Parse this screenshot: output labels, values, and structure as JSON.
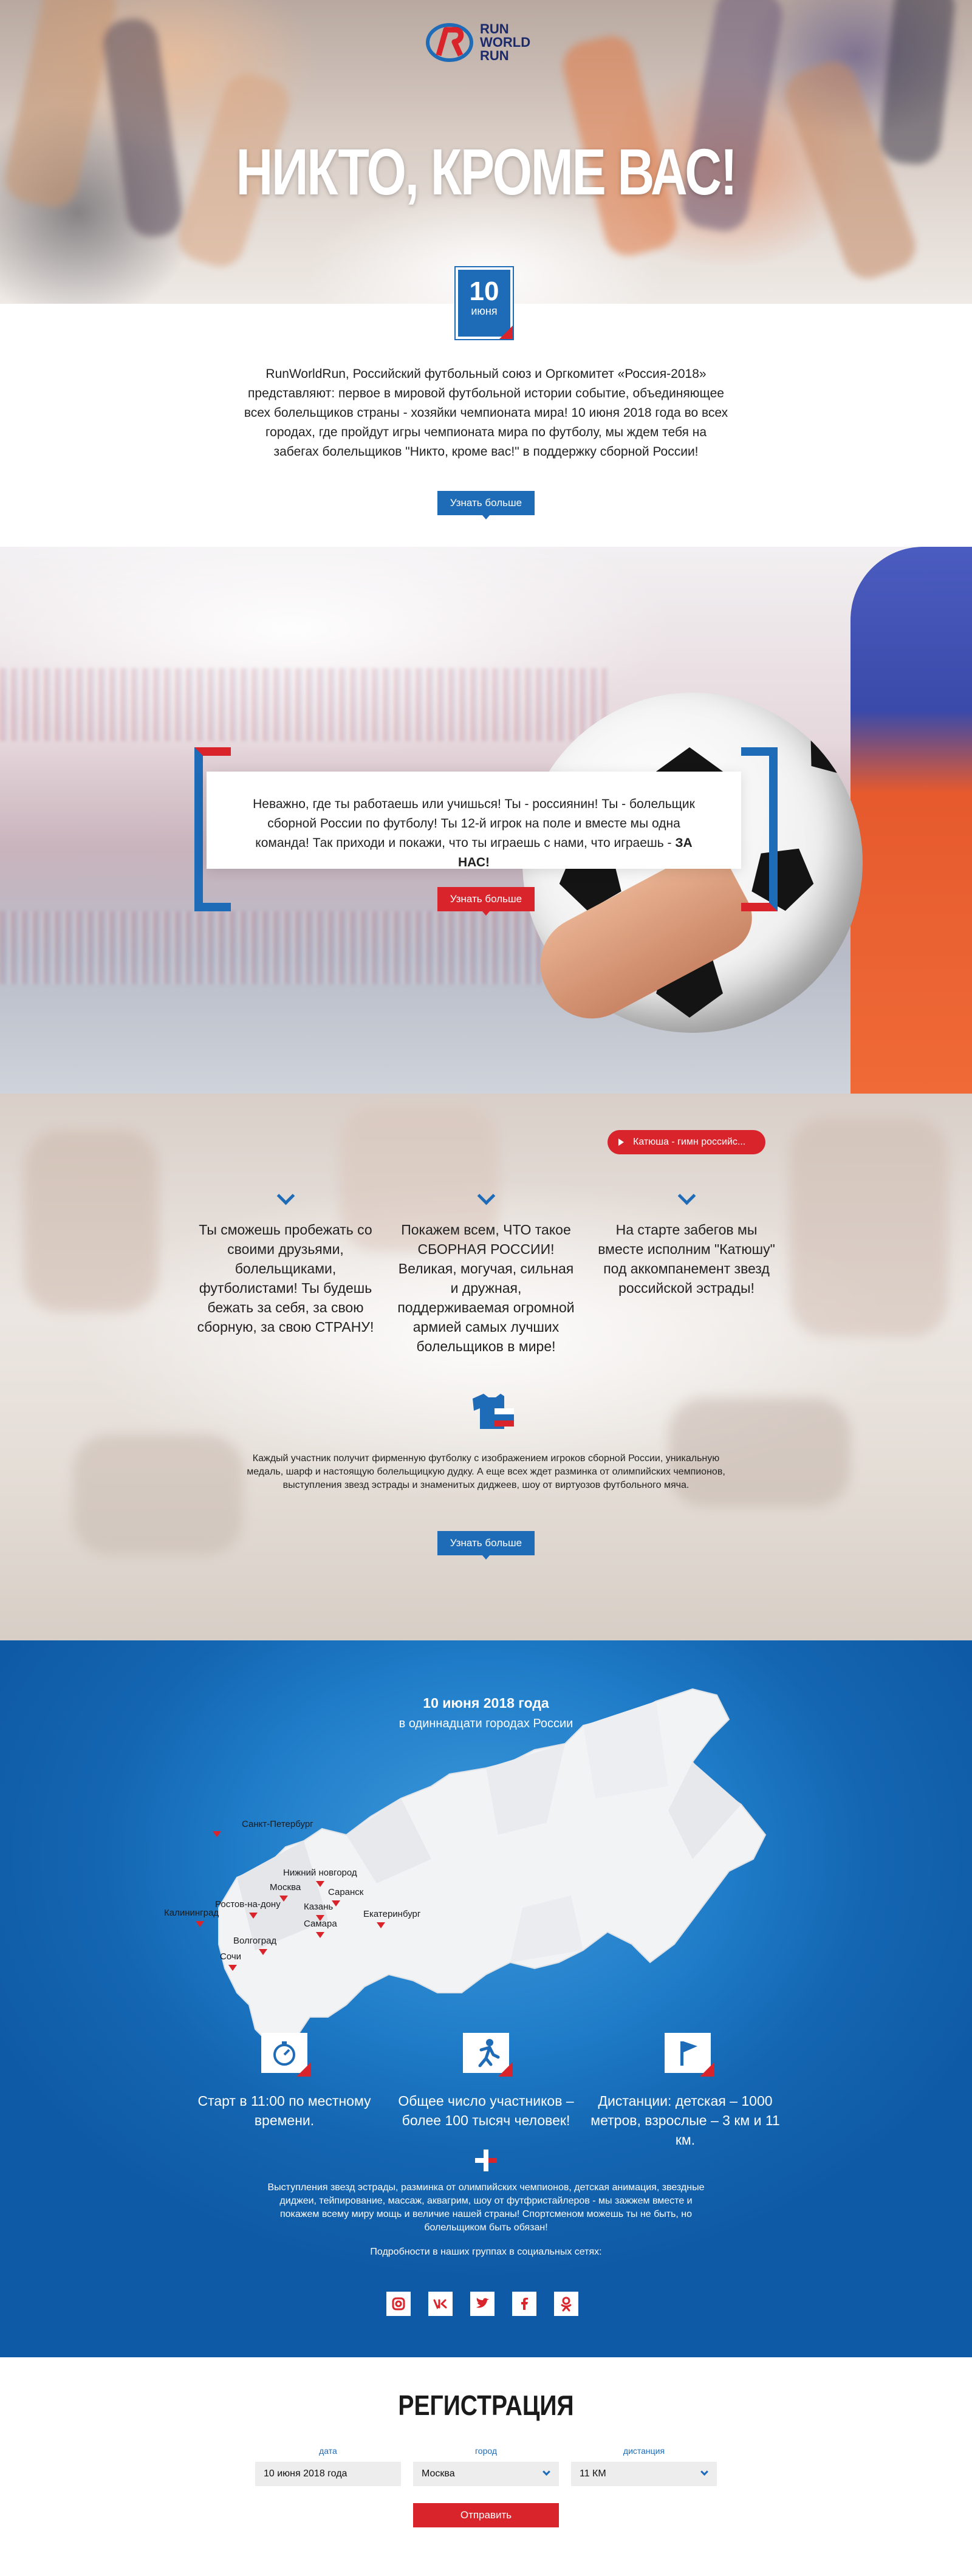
{
  "brand": {
    "logo_line1": "RUN",
    "logo_line2": "WORLD",
    "logo_line3": "RUN",
    "blue": "#1e6bb8",
    "red": "#d8242a"
  },
  "hero": {
    "title": "НИКТО, КРОМЕ ВАС!"
  },
  "date_badge": {
    "day": "10",
    "month": "июня"
  },
  "intro": {
    "text": "RunWorldRun, Российский футбольный союз и Оргкомитет «Россия-2018» представляют: первое в мировой футбольной истории событие, объединяющее всех болельщиков страны - хозяйки чемпионата мира! 10 июня 2018 года во всех городах, где пройдут игры чемпионата мира по футболу, мы ждем тебя на забегах болельщиков \"Никто, кроме вас!\" в поддержку сборной России!",
    "button": "Узнать больше"
  },
  "ball_section": {
    "text": "Неважно, где ты работаешь или учишься! Ты - россиянин! Ты - болельщик сборной России по футболу! Ты 12-й игрок на поле и вместе мы одна команда! Так приходи и покажи, что ты играешь с нами, что играешь -",
    "text_bold": "ЗА НАС!",
    "button": "Узнать больше"
  },
  "runners_section": {
    "music_label": "Катюша - гимн российс...",
    "features": [
      "Ты сможешь пробежать со своими друзьями, болельщиками, футболистами! Ты будешь бежать за себя, за свою сборную, за свою СТРАНУ!",
      "Покажем всем, ЧТО такое СБОРНАЯ РОССИИ! Великая, могучая, сильная и дружная, поддерживаемая огромной армией самых лучших болельщиков в мире!",
      "На старте забегов мы вместе исполним \"Катюшу\" под аккомпанемент звезд российской эстрады!"
    ],
    "text": "Каждый участник получит фирменную футболку с изображением игроков сборной России, уникальную медаль, шарф и настоящую болельщицкую дудку. А еще всех ждет разминка от олимпийских чемпионов, выступления звезд эстрады и знаменитых диджеев, шоу от виртуозов футбольного мяча.",
    "button": "Узнать больше"
  },
  "map_section": {
    "title": "10 июня 2018 года",
    "subtitle": "в одиннадцати городах России",
    "cities": [
      "Санкт-Петербург",
      "Нижний новгород",
      "Москва",
      "Саранск",
      "Ростов-на-дону",
      "Казань",
      "Калининград",
      "Екатеринбург",
      "Самара",
      "Волгоград",
      "Сочи"
    ],
    "info": [
      {
        "icon": "stopwatch-icon",
        "text": "Старт в 11:00 по местному времени."
      },
      {
        "icon": "runner-icon",
        "text": "Общее число участников – более 100 тысяч человек!"
      },
      {
        "icon": "flag-icon",
        "text": "Дистанции: детская – 1000 метров, взрослые – 3 км и 11 км."
      }
    ],
    "text": "Выступления звезд эстрады, разминка от олимпийских чемпионов, детская анимация, звездные диджеи, тейпирование, массаж, аквагрим, шоу от футфристайлеров - мы зажжем вместе и покажем всему миру мощь и величие нашей страны! Спортсменом можешь ты не быть, но болельщиком быть обязан!",
    "social_note": "Подробности в наших группах в социальных сетях:",
    "socials": [
      "instagram-icon",
      "vk-icon",
      "twitter-icon",
      "facebook-icon",
      "odnoklassniki-icon"
    ]
  },
  "registration": {
    "title": "РЕГИСТРАЦИЯ",
    "labels": {
      "date": "дата",
      "city": "город",
      "distance": "дистанция"
    },
    "values": {
      "date": "10 июня 2018 года",
      "city": "Москва",
      "distance": "11 КМ"
    },
    "submit": "Отправить"
  }
}
